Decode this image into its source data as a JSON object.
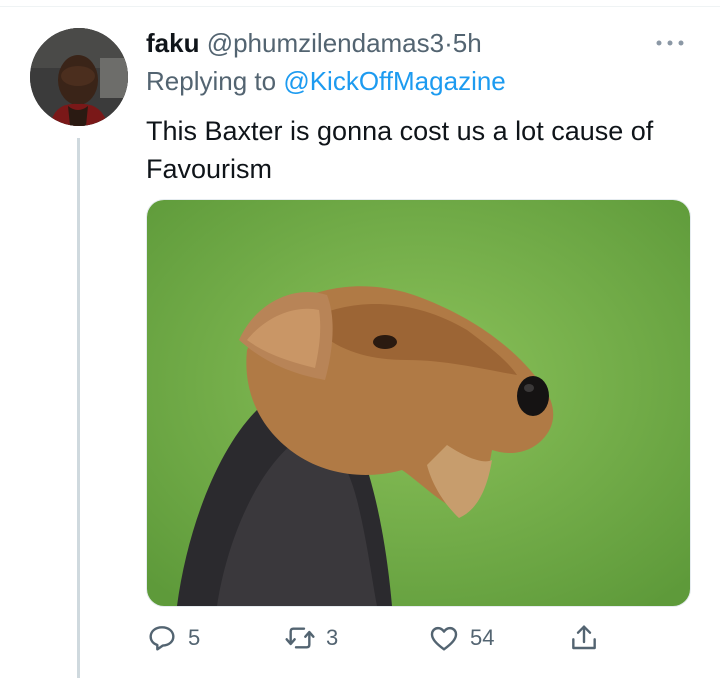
{
  "tweet": {
    "display_name": "faku",
    "handle": "@phumzilendamas3",
    "separator": "·",
    "time": "5h",
    "replying_prefix": "Replying to ",
    "replying_to": "@KickOffMagazine",
    "text": "This Baxter is gonna cost us a lot cause of Favourism",
    "more_icon": "more-icon"
  },
  "actions": {
    "reply_count": "5",
    "retweet_count": "3",
    "like_count": "54"
  },
  "colors": {
    "link": "#1d9bf0",
    "secondary": "#536471",
    "text": "#0f1419",
    "thread_line": "#cfd9de"
  }
}
